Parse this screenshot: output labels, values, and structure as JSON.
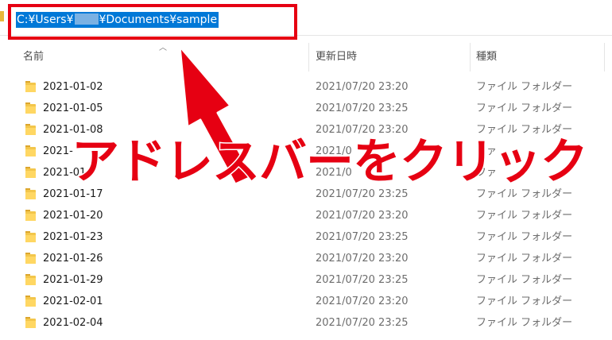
{
  "address_bar": {
    "path_prefix": "C:¥Users¥",
    "path_suffix": "¥Documents¥sample"
  },
  "columns": {
    "name": "名前",
    "date": "更新日時",
    "type": "種類"
  },
  "rows": [
    {
      "name": "2021-01-02",
      "date": "2021/07/20 23:20",
      "type": "ファイル フォルダー"
    },
    {
      "name": "2021-01-05",
      "date": "2021/07/20 23:25",
      "type": "ファイル フォルダー"
    },
    {
      "name": "2021-01-08",
      "date": "2021/07/20 23:20",
      "type": "ファイル フォルダー"
    },
    {
      "name": "2021-",
      "date": "2021/0",
      "type": "ファ"
    },
    {
      "name": "2021-01",
      "date": "2021/0",
      "type": "ファ"
    },
    {
      "name": "2021-01-17",
      "date": "2021/07/20 23:25",
      "type": "ファイル フォルダー"
    },
    {
      "name": "2021-01-20",
      "date": "2021/07/20 23:20",
      "type": "ファイル フォルダー"
    },
    {
      "name": "2021-01-23",
      "date": "2021/07/20 23:25",
      "type": "ファイル フォルダー"
    },
    {
      "name": "2021-01-26",
      "date": "2021/07/20 23:20",
      "type": "ファイル フォルダー"
    },
    {
      "name": "2021-01-29",
      "date": "2021/07/20 23:25",
      "type": "ファイル フォルダー"
    },
    {
      "name": "2021-02-01",
      "date": "2021/07/20 23:20",
      "type": "ファイル フォルダー"
    },
    {
      "name": "2021-02-04",
      "date": "2021/07/20 23:25",
      "type": "ファイル フォルダー"
    }
  ],
  "annotation": {
    "text": "アドレスバーをクリック",
    "color": "#e60012"
  },
  "colors": {
    "selection": "#0078d7",
    "highlight_box": "#e60012",
    "folder": "#f3c64b"
  }
}
